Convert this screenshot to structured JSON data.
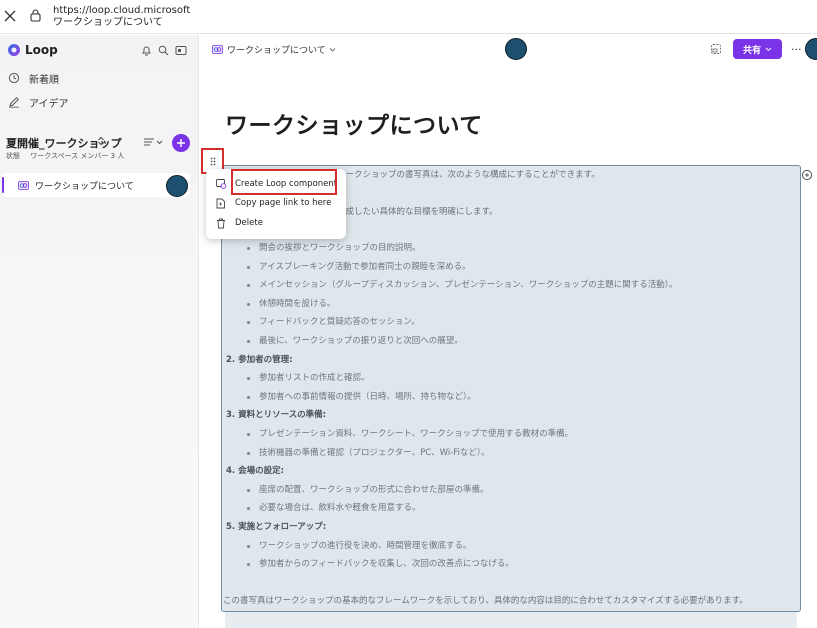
{
  "browser": {
    "url": "https://loop.cloud.microsoft",
    "page_title": "ワークショップについて"
  },
  "sidebar": {
    "app_name": "Loop",
    "nav": [
      {
        "label": "新着順",
        "icon": "clock-icon"
      },
      {
        "label": "アイデア",
        "icon": "pen-icon"
      }
    ],
    "workspace": {
      "name": "夏開催_ワークショップ",
      "status_label": "状態",
      "members": "ワークスペース メンバー 3 人"
    },
    "pages": [
      {
        "label": "ワークショップについて"
      }
    ]
  },
  "header": {
    "breadcrumb": "ワークショップについて",
    "share_label": "共有",
    "more_label": "···"
  },
  "main": {
    "title": "ワークショップについて",
    "intro": "ワークショップの書写真は、次のような構成にすることができます。",
    "goal_line": "達成したい具体的な目標を明確にします。",
    "sections": [
      {
        "heading": "",
        "items": [
          "開会の挨拶とワークショップの目的説明。",
          "アイスブレーキング活動で参加者同士の親睦を深める。",
          "メインセッション（グループディスカッション、プレゼンテーション、ワークショップの主題に関する活動）。",
          "休憩時間を設ける。",
          "フィードバックと質疑応答のセッション。",
          "最後に、ワークショップの振り返りと次回への展望。"
        ]
      },
      {
        "heading": "2.  参加者の管理:",
        "items": [
          "参加者リストの作成と確認。",
          "参加者への事前情報の提供（日時、場所、持ち物など）。"
        ]
      },
      {
        "heading": "3.  資料とリソースの準備:",
        "items": [
          "プレゼンテーション資料、ワークシート、ワークショップで使用する教材の準備。",
          "技術機器の準備と確認（プロジェクター、PC、Wi-Fiなど）。"
        ]
      },
      {
        "heading": "4.  会場の設定:",
        "items": [
          "座席の配置、ワークショップの形式に合わせた部屋の準備。",
          "必要な場合は、飲料水や軽食を用意する。"
        ]
      },
      {
        "heading": "5.  実施とフォローアップ:",
        "items": [
          "ワークショップの進行役を決め、時間管理を徹底する。",
          "参加者からのフィードバックを収集し、次回の改善点につなげる。"
        ]
      }
    ],
    "footer": "この書写真はワークショップの基本的なフレームワークを示しており、具体的な内容は目的に合わせてカスタマイズする必要があります。"
  },
  "context_menu": {
    "items": [
      {
        "label": "Create Loop component",
        "icon": "loop-component-icon"
      },
      {
        "label": "Copy page link to here",
        "icon": "page-link-icon"
      },
      {
        "label": "Delete",
        "icon": "trash-icon"
      }
    ]
  },
  "colors": {
    "accent": "#7b33e8",
    "highlight": "#d32f2f",
    "loop_box_bg": "#dfe7ec",
    "loop_box_border": "#6f8ea6"
  }
}
